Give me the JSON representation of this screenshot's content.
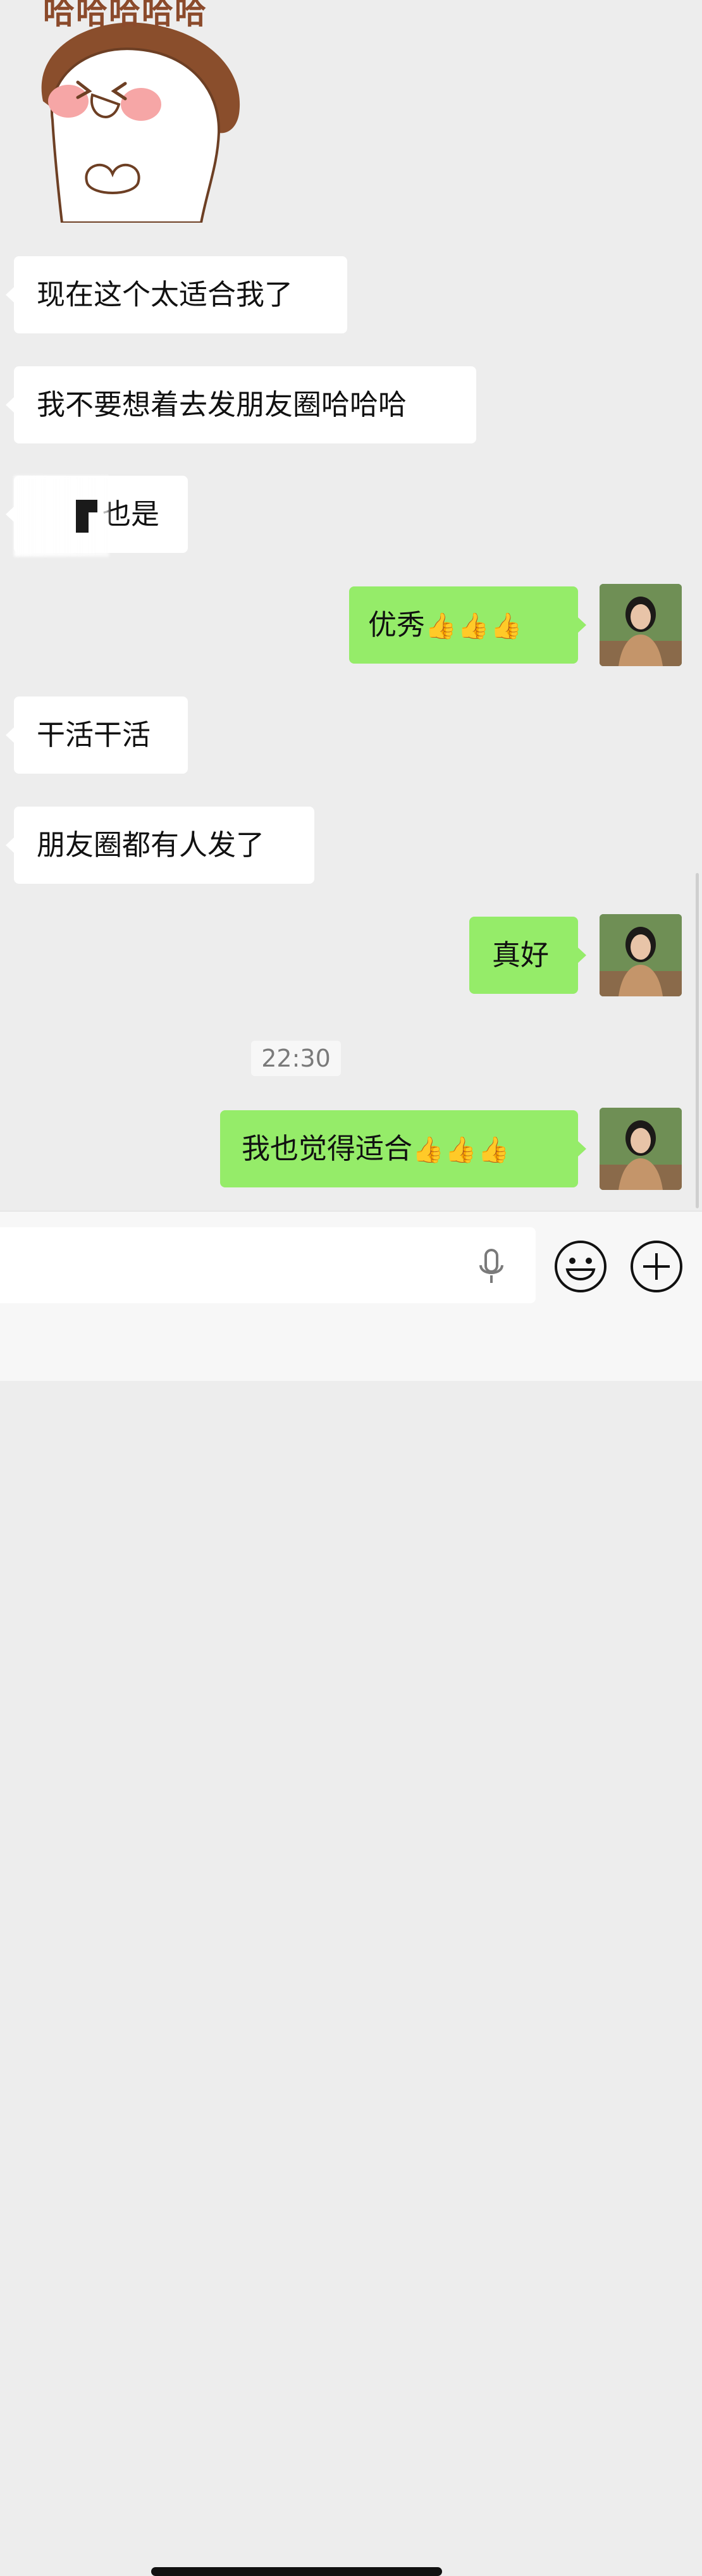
{
  "sticker": {
    "caption": "哈哈哈哈哈"
  },
  "messages": [
    {
      "side": "in",
      "text": "现在这个太适合我了"
    },
    {
      "side": "in",
      "text": "我不要想着去发朋友圈哈哈哈"
    },
    {
      "side": "in",
      "text": "也是",
      "obscured_prefix": true
    },
    {
      "side": "out",
      "text": "优秀",
      "emoji": "👍👍👍"
    },
    {
      "side": "in",
      "text": "干活干活"
    },
    {
      "side": "in",
      "text": "朋友圈都有人发了"
    },
    {
      "side": "out",
      "text": "真好"
    },
    {
      "side": "out",
      "text": "我也觉得适合",
      "emoji": "👍👍👍"
    }
  ],
  "timestamp": "22:30",
  "input": {
    "placeholder": ""
  },
  "icons": {
    "voice": "microphone-icon",
    "emoji": "smiley-icon",
    "more": "plus-icon"
  },
  "colors": {
    "background": "#ededed",
    "incoming_bubble": "#ffffff",
    "outgoing_bubble": "#95ec69",
    "input_bar": "#f7f7f7"
  }
}
